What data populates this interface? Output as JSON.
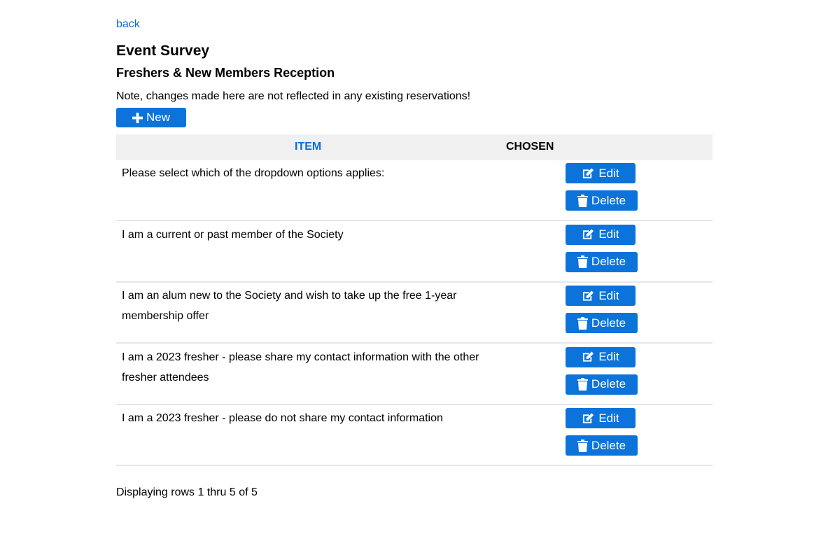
{
  "nav": {
    "back_label": "back"
  },
  "header": {
    "title": "Event Survey",
    "event_name": "Freshers & New Members Reception",
    "note": "Note, changes made here are not reflected in any existing reservations!"
  },
  "toolbar": {
    "new_label": "New",
    "new_icon": "plus-icon"
  },
  "table": {
    "columns": [
      "ITEM",
      "CHOSEN"
    ],
    "header_bg": "#f0f0f0",
    "rows": [
      {
        "item": "Please select which of the dropdown options applies:",
        "edit_label": "Edit",
        "delete_label": "Delete"
      },
      {
        "item": "I am a current or past member of the Society",
        "edit_label": "Edit",
        "delete_label": "Delete"
      },
      {
        "item": "I am an alum new to the Society and wish to take up the free 1-year membership offer",
        "edit_label": "Edit",
        "delete_label": "Delete"
      },
      {
        "item": "I am a 2023 fresher - please share my contact information with the other fresher attendees",
        "edit_label": "Edit",
        "delete_label": "Delete"
      },
      {
        "item": "I am a 2023 fresher - please do not share my contact information",
        "edit_label": "Edit",
        "delete_label": "Delete"
      }
    ]
  },
  "footer": {
    "status": "Displaying rows 1 thru 5 of 5"
  },
  "colors": {
    "accent": "#0b73da",
    "link": "#0b6bd4",
    "row_divider": "#e6e6e6"
  },
  "icons": {
    "edit": "edit-icon",
    "delete": "trash-icon"
  }
}
